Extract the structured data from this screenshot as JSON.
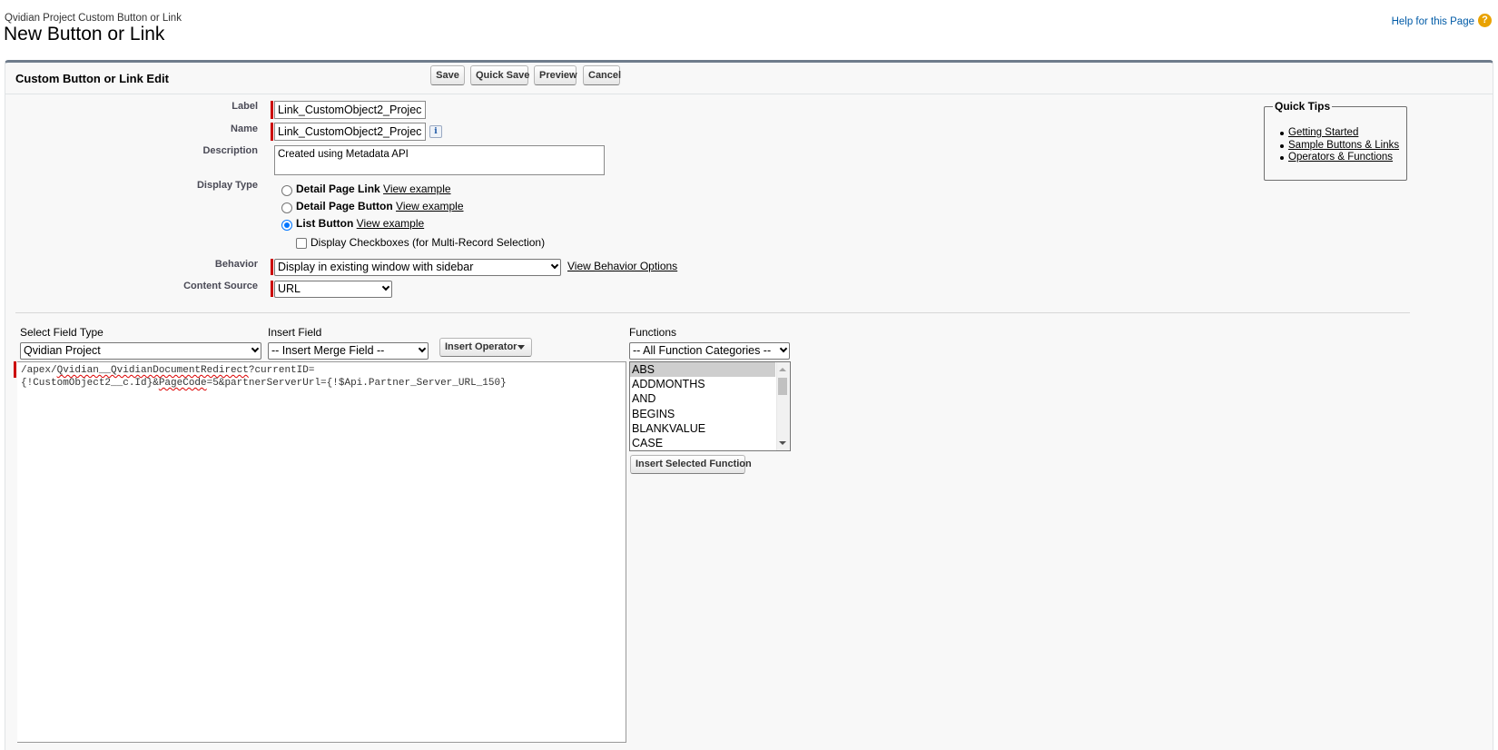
{
  "header": {
    "subtitle": "Qvidian Project Custom Button or Link",
    "title": "New Button or Link",
    "help_link": "Help for this Page",
    "help_icon": "?"
  },
  "panel": {
    "title": "Custom Button or Link Edit",
    "buttons": {
      "save": "Save",
      "quick_save": "Quick Save",
      "preview": "Preview",
      "cancel": "Cancel"
    }
  },
  "form": {
    "label": {
      "caption": "Label",
      "value": "Link_CustomObject2_Projec"
    },
    "name": {
      "caption": "Name",
      "value": "Link_CustomObject2_Projec",
      "info_icon": "i"
    },
    "description": {
      "caption": "Description",
      "value": "Created using Metadata API"
    },
    "display_type": {
      "caption": "Display Type",
      "options": [
        {
          "label": "Detail Page Link",
          "link": "View example",
          "selected": false
        },
        {
          "label": "Detail Page Button",
          "link": "View example",
          "selected": false
        },
        {
          "label": "List Button",
          "link": "View example",
          "selected": true
        }
      ],
      "checkbox_label": "Display Checkboxes (for Multi-Record Selection)",
      "checkbox_checked": false
    },
    "behavior": {
      "caption": "Behavior",
      "value": "Display in existing window with sidebar",
      "link": "View Behavior Options"
    },
    "content_source": {
      "caption": "Content Source",
      "value": "URL"
    }
  },
  "editor": {
    "field_type": {
      "caption": "Select Field Type",
      "value": "Qvidian Project"
    },
    "insert_field": {
      "caption": "Insert Field",
      "value": "-- Insert Merge Field --"
    },
    "insert_operator": "Insert Operator",
    "code": {
      "line1": {
        "a": "/apex/",
        "b": "Qvidian__QvidianDocumentRedirect",
        "c": "?currentID="
      },
      "line2": {
        "a": "{!CustomObject2__c.Id}&",
        "b": "PageCode",
        "c": "=5&partnerServerUrl={!$Api.Partner_Server_URL_150}"
      }
    },
    "functions": {
      "caption": "Functions",
      "category": "-- All Function Categories --",
      "items": [
        "ABS",
        "ADDMONTHS",
        "AND",
        "BEGINS",
        "BLANKVALUE",
        "CASE"
      ],
      "selected": "ABS",
      "insert_button": "Insert Selected Function"
    }
  },
  "quick_tips": {
    "title": "Quick Tips",
    "links": [
      "Getting Started",
      "Sample Buttons & Links",
      "Operators & Functions"
    ]
  }
}
